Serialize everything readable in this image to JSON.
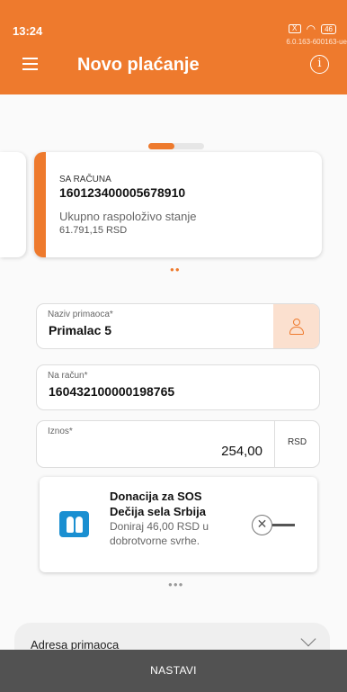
{
  "status_bar": {
    "time": "13:24",
    "sim_label": "X",
    "battery": "46",
    "version": "6.0.163-600163-ue"
  },
  "header": {
    "title": "Novo plaćanje",
    "info_symbol": "i"
  },
  "pager": {
    "active_index": 0,
    "total": 2
  },
  "account": {
    "label": "SA RAČUNA",
    "number": "160123400005678910",
    "balance_label": "Ukupno raspoloživo stanje",
    "balance": "61.791,15 RSD"
  },
  "form": {
    "recipient": {
      "label": "Naziv primaoca*",
      "value": "Primalac 5"
    },
    "account": {
      "label": "Na račun*",
      "value": "160432100000198765"
    },
    "amount": {
      "label": "Iznos*",
      "value": "254,00",
      "currency": "RSD"
    }
  },
  "donation": {
    "title": "Donacija za SOS Dečija sela Srbija",
    "subtitle": "Doniraj 46,00 RSD u dobrotvorne svrhe."
  },
  "address": {
    "label": "Adresa primaoca"
  },
  "footer": {
    "button_label": "NASTAVI"
  },
  "colors": {
    "accent": "#ee7a2d",
    "footer": "#525252",
    "contact_bg": "#fbe0cf"
  },
  "icons": [
    "menu-icon",
    "info-icon",
    "person-icon",
    "sos-logo",
    "toggle-icon",
    "chevron-down-icon",
    "wifi-icon",
    "battery-icon"
  ]
}
